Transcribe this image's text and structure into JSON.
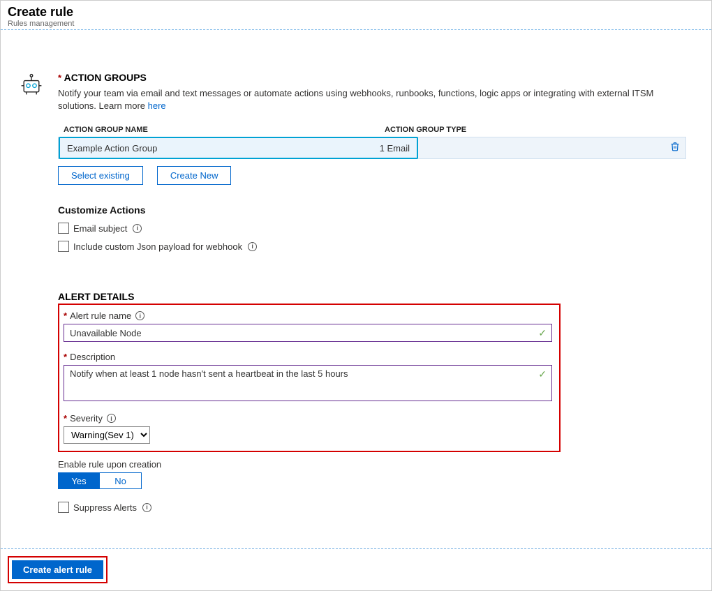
{
  "header": {
    "title": "Create rule",
    "subtitle": "Rules management"
  },
  "actionGroups": {
    "title": "ACTION GROUPS",
    "desc": "Notify your team via email and text messages or automate actions using webhooks, runbooks, functions, logic apps or integrating with external ITSM solutions. Learn more ",
    "learn_link": "here",
    "col_name": "ACTION GROUP NAME",
    "col_type": "ACTION GROUP TYPE",
    "rows": [
      {
        "name": "Example Action Group",
        "type": "1 Email"
      }
    ],
    "select_existing": "Select existing",
    "create_new": "Create New"
  },
  "customize": {
    "title": "Customize Actions",
    "email_subject": "Email subject",
    "json_payload": "Include custom Json payload for webhook"
  },
  "alert": {
    "title": "ALERT DETAILS",
    "name_label": "Alert rule name",
    "name_value": "Unavailable Node",
    "desc_label": "Description",
    "desc_value": "Notify when at least 1 node hasn't sent a heartbeat in the last 5 hours",
    "severity_label": "Severity",
    "severity_value": "Warning(Sev 1)",
    "enable_label": "Enable rule upon creation",
    "yes": "Yes",
    "no": "No",
    "suppress": "Suppress Alerts"
  },
  "footer": {
    "create": "Create alert rule"
  }
}
